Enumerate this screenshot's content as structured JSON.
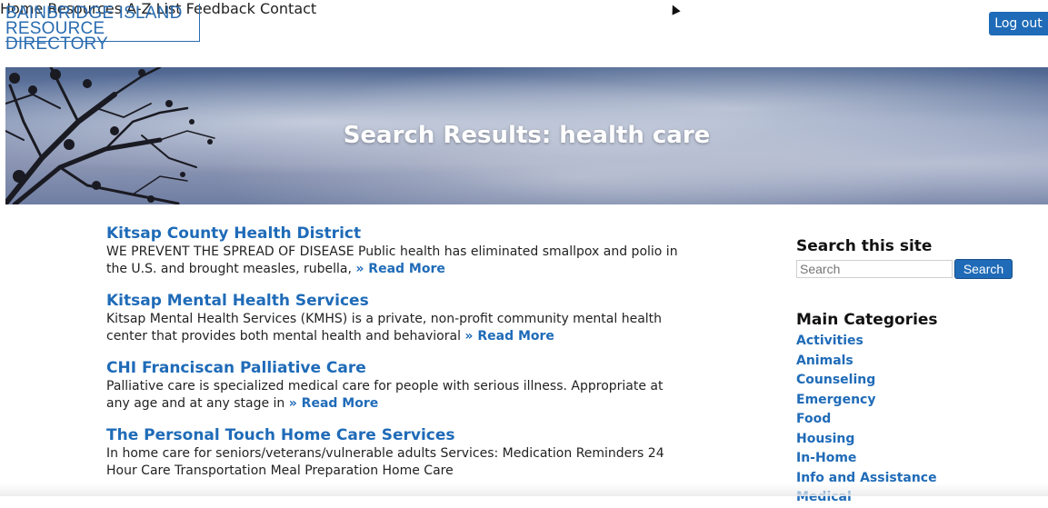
{
  "logo": {
    "line1": "BAINBRIDGE ISLAND",
    "line2": "RESOURCE DIRECTORY"
  },
  "nav": {
    "items": [
      "Home",
      "Resources",
      "A-Z List",
      "Feedback",
      "Contact"
    ],
    "logout_label": "Log out"
  },
  "hero": {
    "title": "Search Results: health care"
  },
  "results": [
    {
      "title": "Kitsap County Health District",
      "text": "WE PREVENT THE SPREAD OF DISEASE Public health has eliminated smallpox and polio in the U.S. and brought measles, rubella,",
      "read_more": "» Read More"
    },
    {
      "title": "Kitsap Mental Health Services",
      "text": "Kitsap Mental Health Services (KMHS) is a private, non-profit community mental health center that provides both mental health and behavioral",
      "read_more": "» Read More"
    },
    {
      "title": "CHI Franciscan Palliative Care",
      "text": "Palliative care is specialized medical care for people with serious illness. Appropriate at any age and at any stage in",
      "read_more": "» Read More"
    },
    {
      "title": "The Personal Touch Home Care Services",
      "text": "In home care for seniors/veterans/vulnerable adults Services: Medication Reminders 24 Hour Care Transportation Meal Preparation Home Care",
      "read_more": ""
    }
  ],
  "sidebar": {
    "search_heading": "Search this site",
    "search_placeholder": "Search",
    "search_button": "Search",
    "categories_heading": "Main Categories",
    "categories": [
      "Activities",
      "Animals",
      "Counseling",
      "Emergency",
      "Food",
      "Housing",
      "In-Home",
      "Info and Assistance",
      "Medical"
    ]
  },
  "colors": {
    "accent": "#1f6bb8",
    "text": "#222222"
  }
}
